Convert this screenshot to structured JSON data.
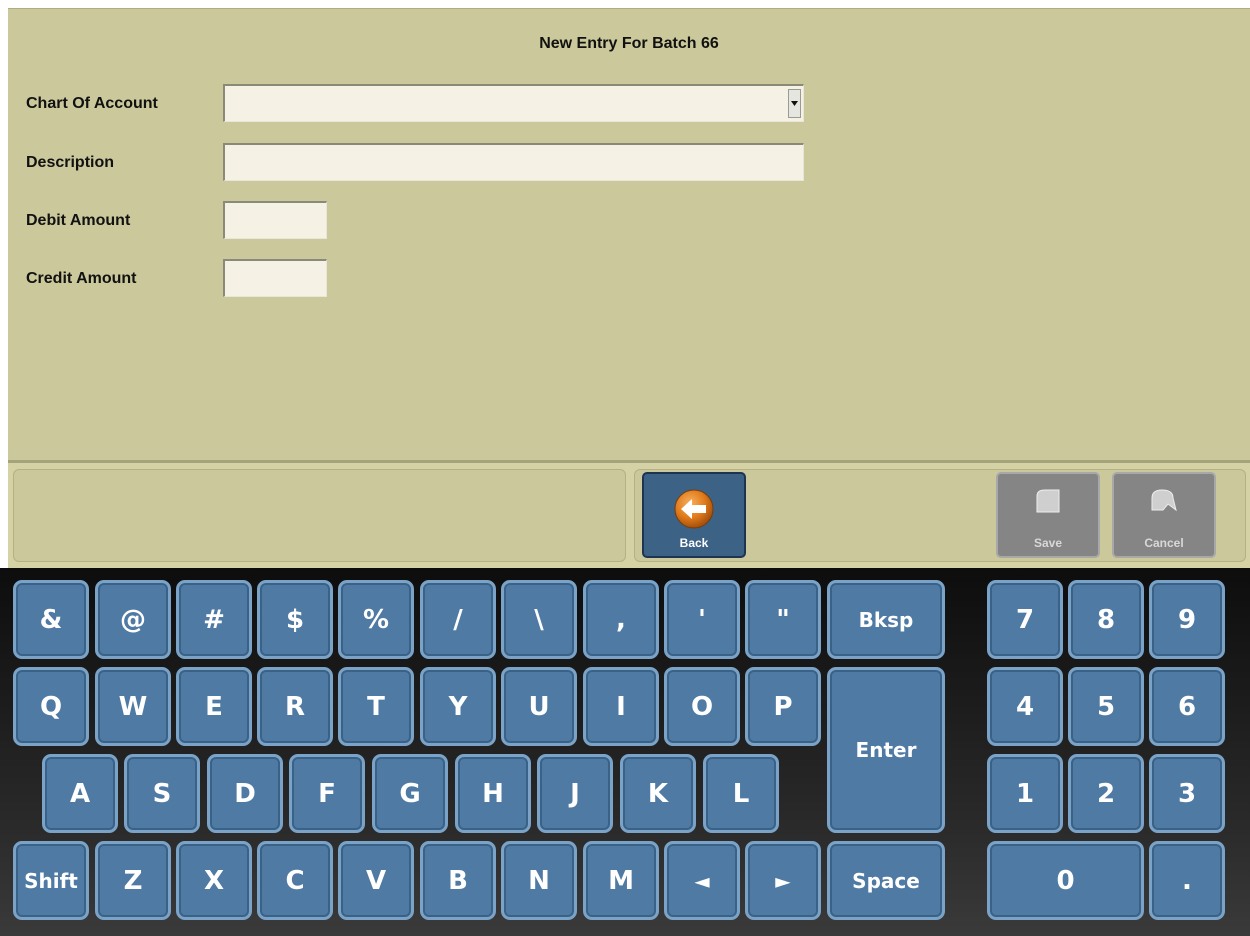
{
  "form": {
    "title": "New Entry For Batch 66",
    "fields": [
      {
        "label": "Chart Of Account",
        "value": "",
        "type": "select"
      },
      {
        "label": "Description",
        "value": ""
      },
      {
        "label": "Debit Amount",
        "value": ""
      },
      {
        "label": "Credit Amount",
        "value": ""
      }
    ]
  },
  "toolbar": {
    "back_label": "Back",
    "save_label": "Save",
    "cancel_label": "Cancel"
  },
  "keyboard": {
    "row1": [
      "&",
      "@",
      "#",
      "$",
      "%",
      "/",
      "\\",
      ",",
      "'",
      "\""
    ],
    "bksp": "Bksp",
    "row2": [
      "Q",
      "W",
      "E",
      "R",
      "T",
      "Y",
      "U",
      "I",
      "O",
      "P"
    ],
    "enter": "Enter",
    "row3": [
      "A",
      "S",
      "D",
      "F",
      "G",
      "H",
      "J",
      "K",
      "L"
    ],
    "row4": [
      "Shift",
      "Z",
      "X",
      "C",
      "V",
      "B",
      "N",
      "M",
      "◄",
      "►"
    ],
    "space": "Space",
    "numpad": [
      "7",
      "8",
      "9",
      "4",
      "5",
      "6",
      "1",
      "2",
      "3",
      "0",
      "."
    ]
  },
  "colors": {
    "form_bg": "#cbc99b",
    "key_bg": "#4f7aa3",
    "back_button": "#3c6286",
    "back_icon": "#e07a1a",
    "disabled_button": "#858585"
  }
}
